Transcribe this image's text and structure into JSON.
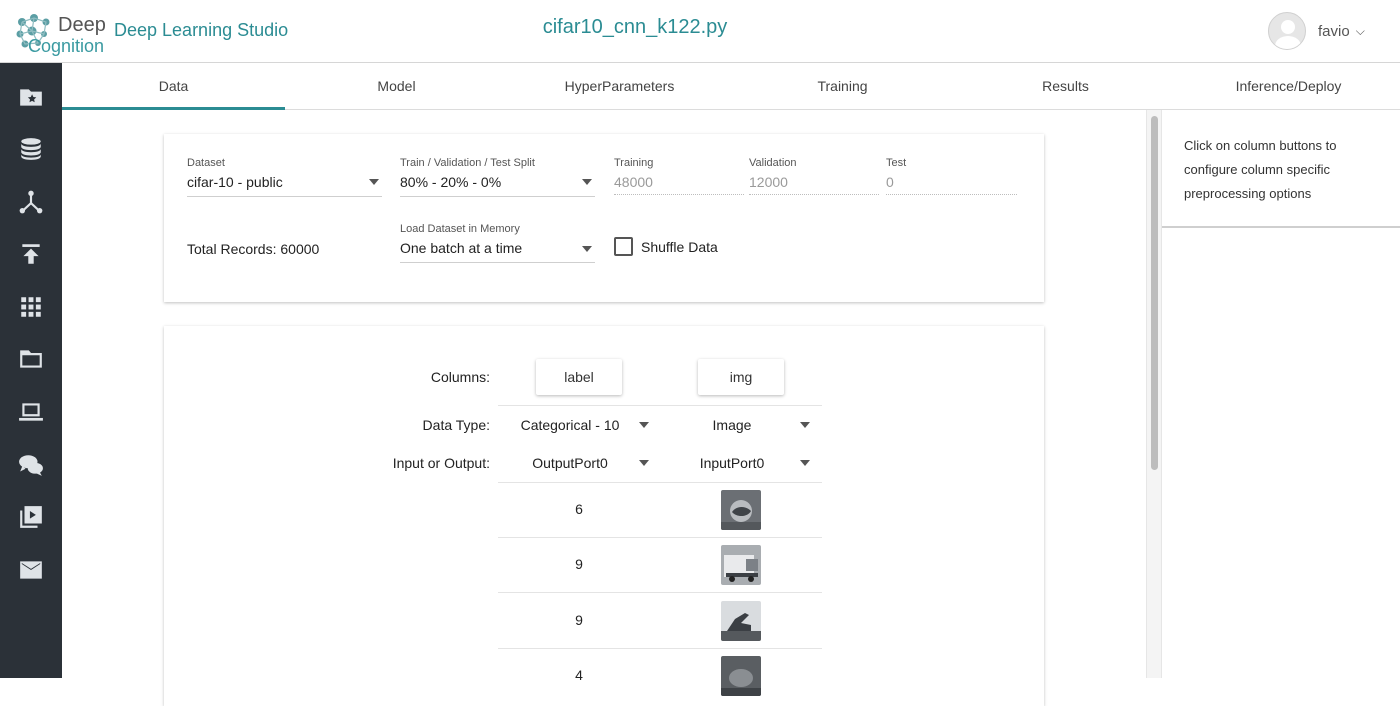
{
  "header": {
    "logo_word1": "Deep",
    "logo_word2": "Cognition",
    "app_name": "Deep Learning Studio",
    "file_name": "cifar10_cnn_k122.py",
    "user_name": "favio"
  },
  "sidebar": {
    "items": [
      {
        "icon": "starred-folder-icon"
      },
      {
        "icon": "database-icon"
      },
      {
        "icon": "network-icon"
      },
      {
        "icon": "upload-icon"
      },
      {
        "icon": "apps-grid-icon"
      },
      {
        "icon": "folder-icon"
      },
      {
        "icon": "laptop-icon"
      },
      {
        "icon": "chat-icon"
      },
      {
        "icon": "video-library-icon"
      },
      {
        "icon": "mail-icon"
      }
    ]
  },
  "tabs": [
    {
      "label": "Data",
      "active": true
    },
    {
      "label": "Model",
      "active": false
    },
    {
      "label": "HyperParameters",
      "active": false
    },
    {
      "label": "Training",
      "active": false
    },
    {
      "label": "Results",
      "active": false
    },
    {
      "label": "Inference/Deploy",
      "active": false
    }
  ],
  "dataset_card": {
    "dataset_label": "Dataset",
    "dataset_value": "cifar-10 - public",
    "split_label": "Train / Validation / Test Split",
    "split_value": "80% - 20% - 0%",
    "training_label": "Training",
    "training_value": "48000",
    "validation_label": "Validation",
    "validation_value": "12000",
    "test_label": "Test",
    "test_value": "0",
    "total_records": "Total Records: 60000",
    "load_label": "Load Dataset in Memory",
    "load_value": "One batch at a time",
    "shuffle_label": "Shuffle Data",
    "shuffle_checked": false
  },
  "columns_card": {
    "columns_label": "Columns:",
    "data_type_label": "Data Type:",
    "io_label": "Input or Output:",
    "columns": [
      {
        "name": "label",
        "data_type": "Categorical - 10",
        "io": "OutputPort0"
      },
      {
        "name": "img",
        "data_type": "Image",
        "io": "InputPort0"
      }
    ],
    "rows": [
      {
        "label": "6",
        "img_icon": "cifar-thumbnail-icon"
      },
      {
        "label": "9",
        "img_icon": "cifar-thumbnail-icon"
      },
      {
        "label": "9",
        "img_icon": "cifar-thumbnail-icon"
      },
      {
        "label": "4",
        "img_icon": "cifar-thumbnail-icon"
      }
    ]
  },
  "right_panel": {
    "help_text": "Click on column buttons to configure column specific preprocessing options"
  },
  "colors": {
    "accent": "#2b8c93",
    "sidebar_bg": "#2b3138",
    "sidebar_icon": "#dfe3e7"
  }
}
